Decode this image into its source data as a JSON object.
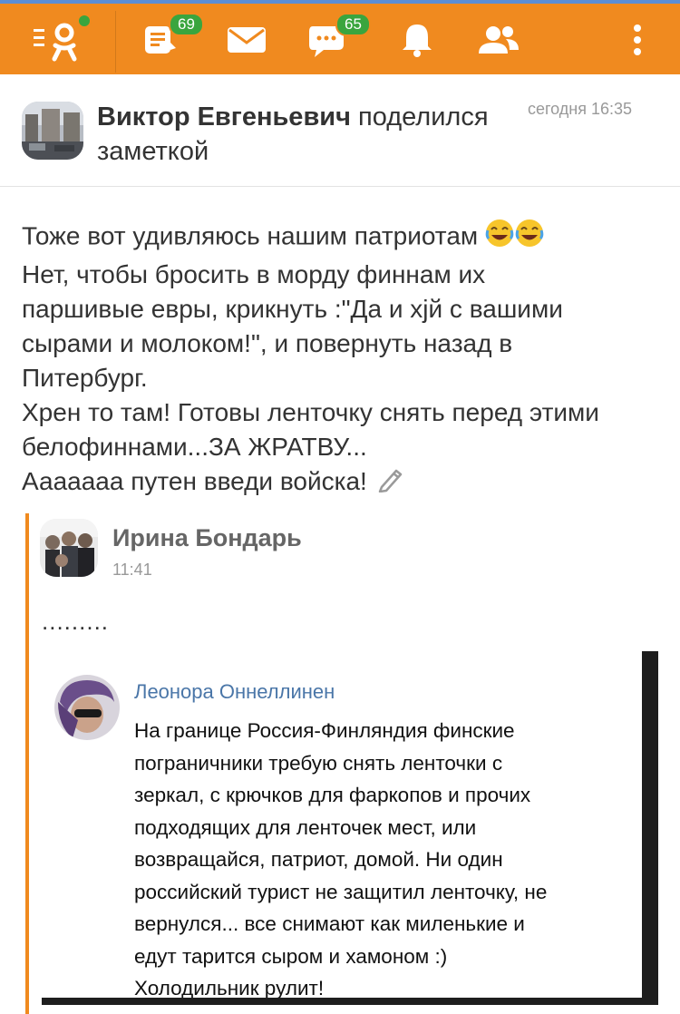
{
  "topbar": {
    "badges": {
      "notes": "69",
      "discussions": "65"
    },
    "icons": [
      "ok-logo-icon",
      "notes-icon",
      "mail-icon",
      "chat-icon",
      "bell-icon",
      "friends-icon",
      "more-icon"
    ],
    "accent_color": "#f08a1f",
    "badge_color": "#3aa53e"
  },
  "post": {
    "author": "Виктор Евгеньевич",
    "action_line1": " поделился",
    "action_line2": "заметкой",
    "time": "сегодня 16:35",
    "text_lines": [
      "Тоже вот удивляюсь нашим патриотам",
      "Нет, чтобы бросить в морду финнам их",
      "паршивые евры, крикнуть :\"Да и хјй с вашими",
      "сырами и молоком!\", и повернуть назад в",
      "Питербург.",
      "Хрен то там! Готовы ленточку снять перед этими",
      "белофиннами...ЗА ЖРАТВУ...",
      "Ааааааа путен введи войска!"
    ]
  },
  "shared": {
    "name": "Ирина Бондарь",
    "time": "11:41",
    "text": "........."
  },
  "embed": {
    "name": "Леонора Оннеллинен",
    "text_lines": [
      "На границе Россия-Финляндия финские",
      "пограничники требую снять ленточки с",
      "зеркал, с крючков для фаркопов и прочих",
      "подходящих для ленточек мест, или",
      "возвращайся, патриот, домой. Ни один",
      "российский турист не защитил ленточку, не",
      "вернулся... все снимают как миленькие и",
      "едут тарится сыром и хамоном :)",
      "Холодильник рулит!"
    ]
  }
}
